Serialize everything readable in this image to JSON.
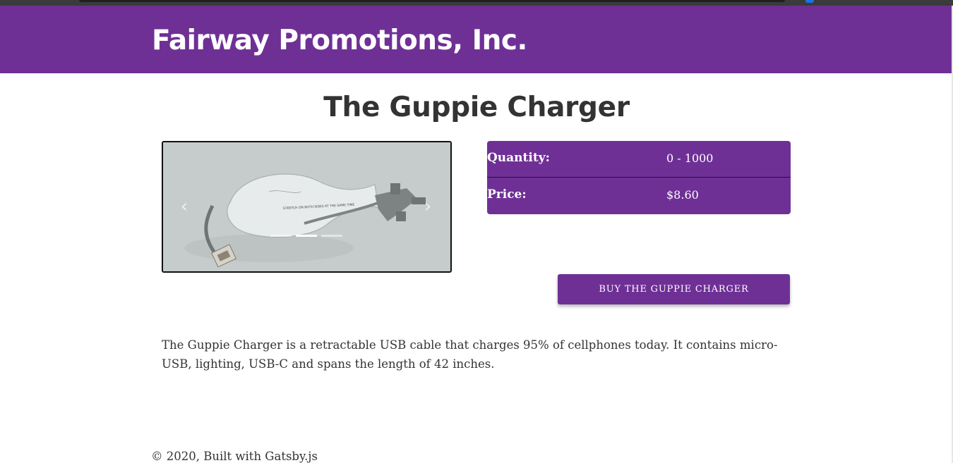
{
  "site": {
    "title": "Fairway Promotions, Inc."
  },
  "product": {
    "title": "The Guppie Charger",
    "quantity_label": "Quantity:",
    "quantity_value": "0 - 1000",
    "price_label": "Price:",
    "price_value": "$8.60",
    "buy_label": "BUY THE GUPPIE CHARGER",
    "description": "The Guppie Charger is a retractable USB cable that charges 95% of cellphones today. It contains micro-USB, lighting, USB-C and spans the length of 42 inches."
  },
  "carousel": {
    "image_text": "STRETCH ON BOTH SIDES AT THE SAME TIME",
    "prev_icon": "chevron-left-icon",
    "next_icon": "chevron-right-icon",
    "slide_count": 3,
    "active_slide": 2
  },
  "footer": {
    "text": "© 2020, Built with Gatsby.js"
  },
  "colors": {
    "brand": "#6f3096",
    "text": "#333333",
    "background": "#ffffff"
  }
}
